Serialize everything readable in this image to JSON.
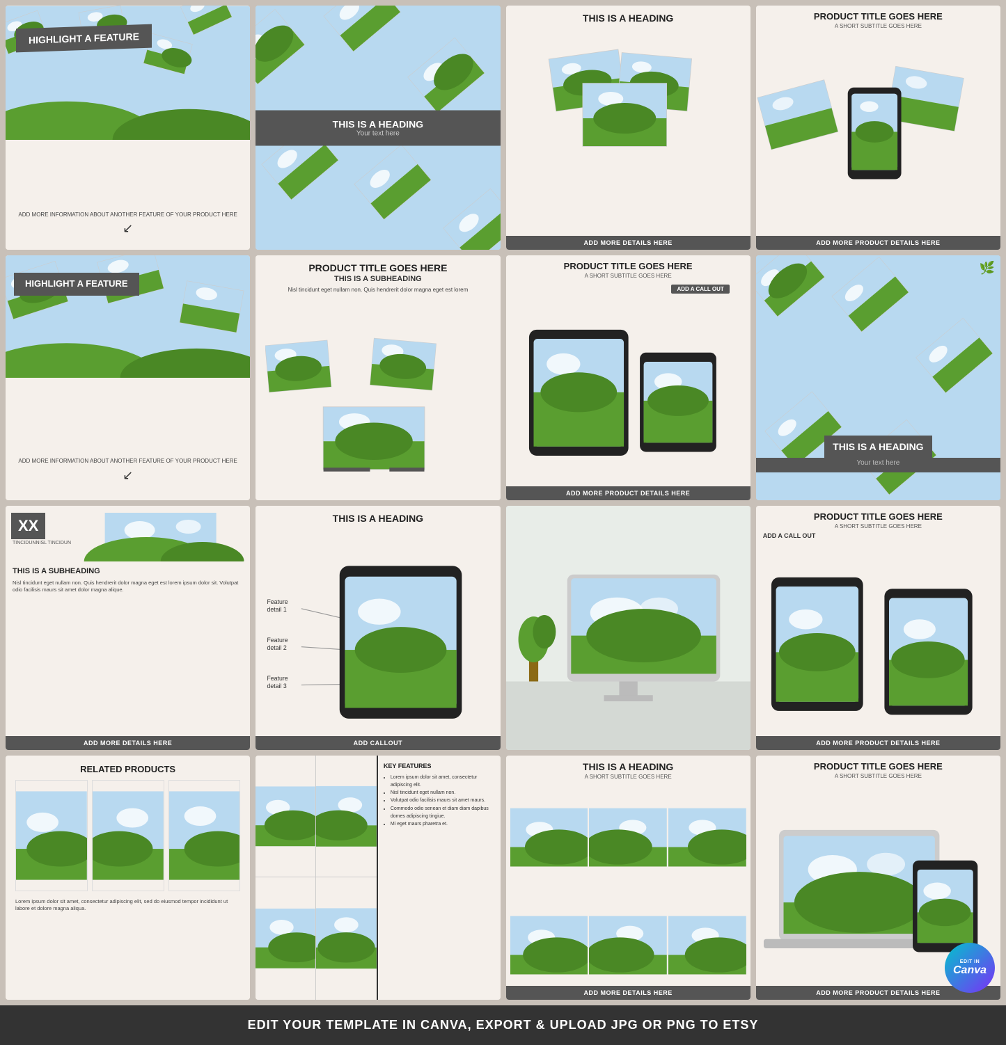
{
  "grid": {
    "cards": [
      {
        "id": "card1",
        "type": "highlight-feature",
        "heading": "HIGHLIGHT A FEATURE",
        "body": "ADD MORE INFORMATION ABOUT ANOTHER FEATURE OF YOUR PRODUCT HERE",
        "has_landscape": true,
        "has_scattered": true
      },
      {
        "id": "card2",
        "type": "scattered-heading",
        "heading": "THIS IS A HEADING",
        "subheading": "Your text here",
        "dark_banner": true
      },
      {
        "id": "card3",
        "type": "heading-details",
        "heading": "THIS IS A HEADING",
        "footer": "ADD MORE DETAILS HERE"
      },
      {
        "id": "card4",
        "type": "product-phone",
        "title": "PRODUCT TITLE GOES HERE",
        "subtitle": "A SHORT SUBTITLE GOES HERE",
        "footer": "ADD MORE PRODUCT DETAILS HERE"
      },
      {
        "id": "card5",
        "type": "highlight-feature-2",
        "heading": "HIGHLIGHT A FEATURE",
        "body": "ADD MORE INFORMATION ABOUT ANOTHER FEATURE OF YOUR PRODUCT HERE",
        "has_landscape": true
      },
      {
        "id": "card6",
        "type": "product-stacked",
        "title": "PRODUCT TITLE GOES HERE",
        "subheading": "THIS IS A SUBHEADING",
        "body": "Nisl tincidunt eget nullam non. Quis hendrerit dolor magna eget est lorem",
        "footer": ""
      },
      {
        "id": "card7",
        "type": "product-devices",
        "title": "PRODUCT TITLE GOES HERE",
        "subtitle": "A SHORT SUBTITLE GOES HERE",
        "callout": "ADD A CALL OUT",
        "footer": "ADD MORE PRODUCT DETAILS HERE"
      },
      {
        "id": "card8",
        "type": "scattered-heading-2",
        "heading": "THIS IS A HEADING",
        "subheading": "Your text here"
      },
      {
        "id": "card9",
        "type": "xx-subheading",
        "xx_label": "XX",
        "xx_sub": "TINCIDUNNISL TINCIDUN",
        "heading": "THIS IS A SUBHEADING",
        "body": "Nisl tincidunt eget nullam non. Quis hendrerit dolor magna eget est lorem ipsum dolor sit. Volutpat odio facilisis maurs sit amet dolor magna alique.",
        "footer": "ADD MORE DETAILS HERE"
      },
      {
        "id": "card10",
        "type": "feature-detail-tablet",
        "heading": "THIS IS A HEADING",
        "features": [
          "Feature detail 1",
          "Feature detail 2",
          "Feature detail 3"
        ],
        "callout": "ADD CALLOUT"
      },
      {
        "id": "card11",
        "type": "monitor-scene",
        "footer": ""
      },
      {
        "id": "card12",
        "type": "product-two-tablets",
        "title": "PRODUCT TITLE GOES HERE",
        "subtitle": "A SHORT SUBTITLE GOES HERE",
        "callout": "ADD A CALL OUT",
        "footer": "ADD MORE PRODUCT DETAILS HERE"
      },
      {
        "id": "card13",
        "type": "related-products",
        "heading": "RELATED PRODUCTS",
        "body": "Lorem ipsum dolor sit amet, consectetur adipiscing elit, sed do eiusmod tempor incididunt ut labore et dolore magna aliqua."
      },
      {
        "id": "card14",
        "type": "key-features",
        "heading": "KEY FEATURES",
        "features": [
          "Lorem ipsum dolor sit amet, consectetur adipiscing elit.",
          "Nisl tincidunt eget nullam non.",
          "Volutpat odio facilisis maurs sit amet maurs.",
          "Commodo odio senean et diam diam dapibus domes adipiscing tingiue.",
          "Mi eget maurs pharetra et."
        ]
      },
      {
        "id": "card15",
        "type": "heading-gallery",
        "heading": "THIS IS A HEADING",
        "subtitle": "A SHORT SUBTITLE GOES HERE",
        "footer": "ADD MORE DETAILS HERE"
      },
      {
        "id": "card16",
        "type": "product-laptop-canva",
        "title": "PRODUCT TITLE GOES HERE",
        "subtitle": "A SHORT SUBTITLE GOES HERE",
        "canva_label": "EDIT IN",
        "canva_brand": "Canva",
        "footer": "ADD MORE PRODUCT DETAILS HERE"
      }
    ]
  },
  "footer": {
    "text": "EDIT YOUR TEMPLATE IN CANVA, EXPORT & UPLOAD JPG OR PNG TO ETSY"
  },
  "colors": {
    "sky": "#b8d9f0",
    "hill_green": "#5a9e30",
    "hill_dark": "#4a8825",
    "dark_banner": "#555555",
    "card_bg": "#f5f0eb",
    "footer_bg": "#333333",
    "page_bg": "#c8c0b8"
  }
}
